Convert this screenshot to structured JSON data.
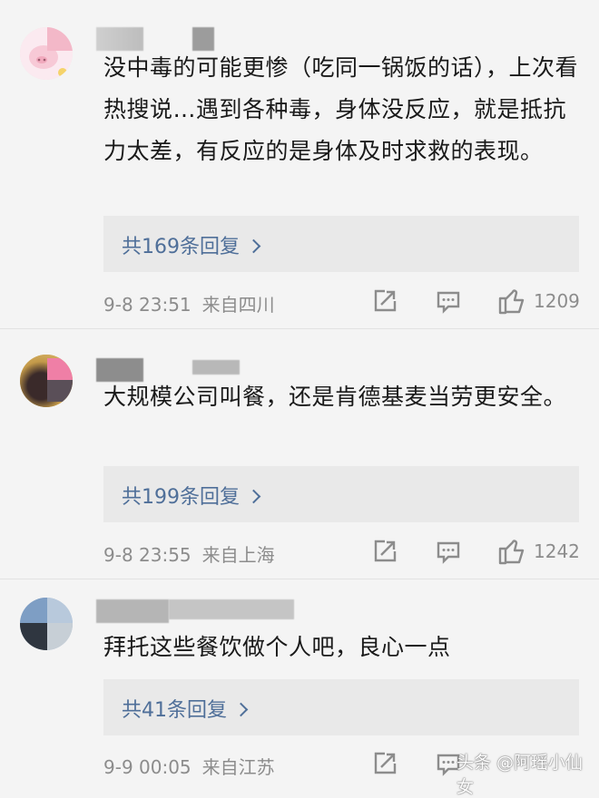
{
  "comments": [
    {
      "text": "没中毒的可能更惨（吃同一锅饭的话），上次看热搜说…遇到各种毒，身体没反应，就是抵抗力太差，有反应的是身体及时求救的表现。",
      "replies_label": "共169条回复",
      "time": "9-8 23:51",
      "location": "来自四川",
      "likes": "1209"
    },
    {
      "text": "大规模公司叫餐，还是肯德基麦当劳更安全。",
      "replies_label": "共199条回复",
      "time": "9-8 23:55",
      "location": "来自上海",
      "likes": "1242"
    },
    {
      "text": "拜托这些餐饮做个人吧，良心一点",
      "replies_label": "共41条回复",
      "time": "9-9 00:05",
      "location": "来自江苏",
      "likes": ""
    }
  ],
  "watermark": "头条 @阿瑶小仙女",
  "colors": {
    "link": "#4f6f99",
    "meta": "#8c8c8c",
    "reply_bg": "#e9e9e9"
  },
  "icons": [
    "repost-icon",
    "comment-icon",
    "like-icon"
  ]
}
